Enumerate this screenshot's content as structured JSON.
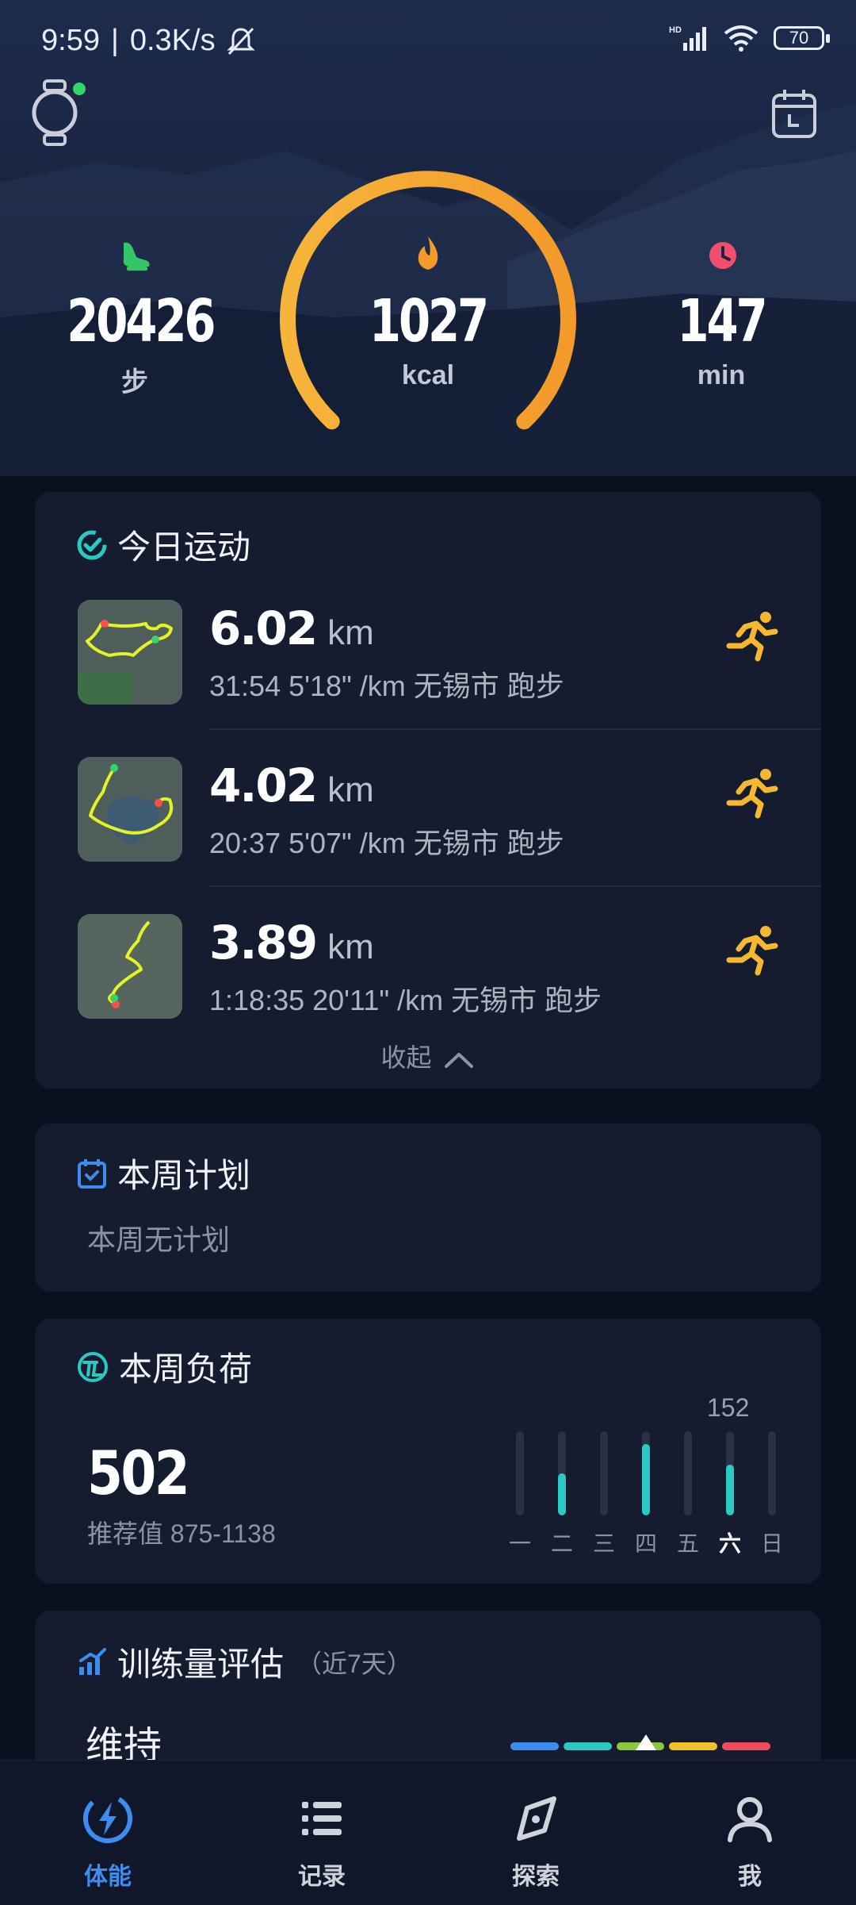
{
  "status_bar": {
    "time": "9:59",
    "net_speed": "0.3K/s",
    "battery": "70",
    "network_badge": "HD"
  },
  "summary": {
    "steps": {
      "value": "20426",
      "unit": "步",
      "icon": "footprint-icon",
      "color": "#35c46a"
    },
    "calories": {
      "value": "1027",
      "unit": "kcal",
      "icon": "flame-icon",
      "color": "#f39a2a",
      "ring_progress": 0.75
    },
    "minutes": {
      "value": "147",
      "unit": "min",
      "icon": "clock-icon",
      "color": "#f0506e"
    }
  },
  "today": {
    "title": "今日运动",
    "runs": [
      {
        "distance": "6.02",
        "unit": "km",
        "detail": "31:54  5'18\" /km  无锡市 跑步",
        "icon": "running-icon"
      },
      {
        "distance": "4.02",
        "unit": "km",
        "detail": "20:37  5'07\" /km  无锡市 跑步",
        "icon": "running-icon"
      },
      {
        "distance": "3.89",
        "unit": "km",
        "detail": "1:18:35  20'11\" /km  无锡市 跑步",
        "icon": "running-icon"
      }
    ],
    "collapse_label": "收起"
  },
  "plan": {
    "title": "本周计划",
    "empty_text": "本周无计划"
  },
  "load": {
    "title": "本周负荷",
    "value": "502",
    "recommended": "推荐值 875-1138",
    "peak_label": "152",
    "days": [
      {
        "label": "一",
        "value": 0
      },
      {
        "label": "二",
        "value": 0.5
      },
      {
        "label": "三",
        "value": 0
      },
      {
        "label": "四",
        "value": 0.85
      },
      {
        "label": "五",
        "value": 0
      },
      {
        "label": "六",
        "value": 0.6,
        "active": true
      },
      {
        "label": "日",
        "value": 0
      }
    ]
  },
  "evaluation": {
    "title": "训练量评估",
    "subtitle": "（近7天）",
    "status": "维持",
    "scale_colors": [
      "#3d8cf0",
      "#2bc9c4",
      "#8cc63f",
      "#f2c12e",
      "#ef4b5c"
    ]
  },
  "nav": [
    {
      "label": "体能",
      "icon": "lightning-icon",
      "active": true
    },
    {
      "label": "记录",
      "icon": "list-icon",
      "active": false
    },
    {
      "label": "探索",
      "icon": "compass-icon",
      "active": false
    },
    {
      "label": "我",
      "icon": "profile-icon",
      "active": false
    }
  ]
}
